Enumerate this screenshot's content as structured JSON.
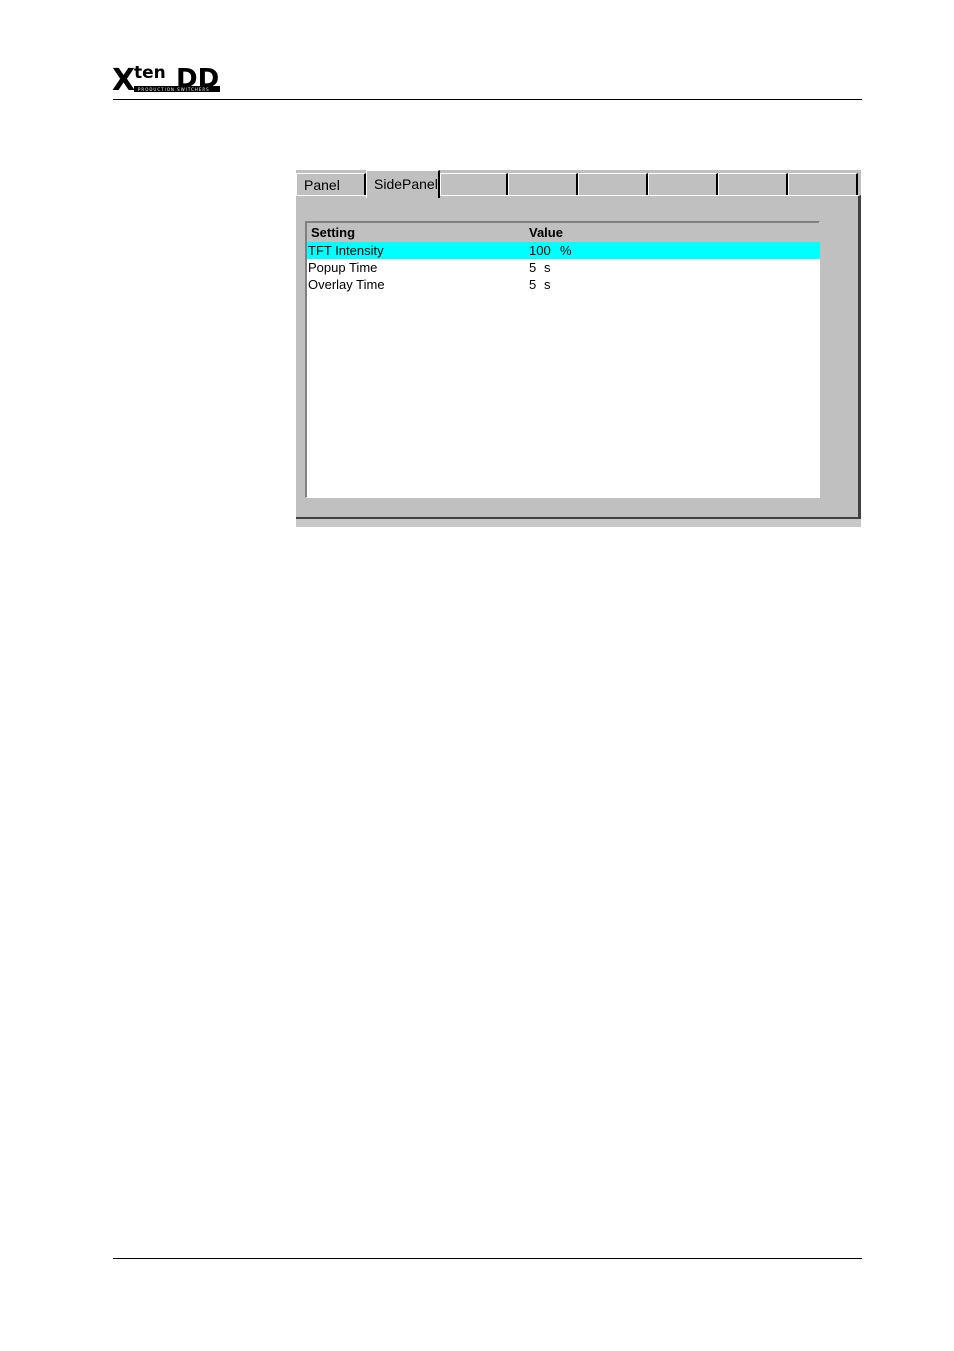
{
  "header": {
    "logo_text_main": "Xten",
    "logo_text_dd": "DD",
    "logo_tagline": "PRODUCTION SWITCHERS"
  },
  "tabs": [
    {
      "label": "Panel",
      "active": false
    },
    {
      "label": "SidePanel",
      "active": true
    },
    {
      "label": "",
      "active": false
    },
    {
      "label": "",
      "active": false
    },
    {
      "label": "",
      "active": false
    },
    {
      "label": "",
      "active": false
    },
    {
      "label": "",
      "active": false
    },
    {
      "label": "",
      "active": false
    }
  ],
  "table": {
    "columns": [
      "Setting",
      "Value"
    ],
    "rows": [
      {
        "setting": "TFT Intensity",
        "value": "100",
        "unit": "%",
        "selected": true
      },
      {
        "setting": "Popup Time",
        "value": "5",
        "unit": "s",
        "selected": false
      },
      {
        "setting": "Overlay Time",
        "value": "5",
        "unit": "s",
        "selected": false
      }
    ]
  },
  "colors": {
    "selection": "#00ffff",
    "window_bg": "#c0c0c0"
  }
}
